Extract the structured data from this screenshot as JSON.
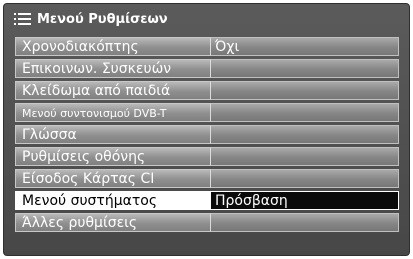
{
  "header": {
    "title": "Μενού Ρυθμίσεων",
    "icon": "list-menu-icon"
  },
  "menu": {
    "items": [
      {
        "label": "Χρονοδιακόπτης",
        "value": "Όχι"
      },
      {
        "label": "Επικοινων. Συσκευών",
        "value": ""
      },
      {
        "label": "Κλείδωμα από παιδιά",
        "value": ""
      },
      {
        "label": "Μενού συντονισμού DVB-T",
        "value": ""
      },
      {
        "label": "Γλώσσα",
        "value": ""
      },
      {
        "label": "Ρυθμίσεις οθόνης",
        "value": ""
      },
      {
        "label": "Είσοδος Κάρτας CI",
        "value": ""
      },
      {
        "label": "Μενού συστήματος",
        "value": "Πρόσβαση",
        "selected": true
      },
      {
        "label": "Άλλες ρυθμίσεις",
        "value": ""
      }
    ]
  },
  "colors": {
    "panel_bg": "#4f4f4f",
    "selected_label_bg": "#ffffff",
    "selected_value_bg": "#0a0a0a"
  }
}
